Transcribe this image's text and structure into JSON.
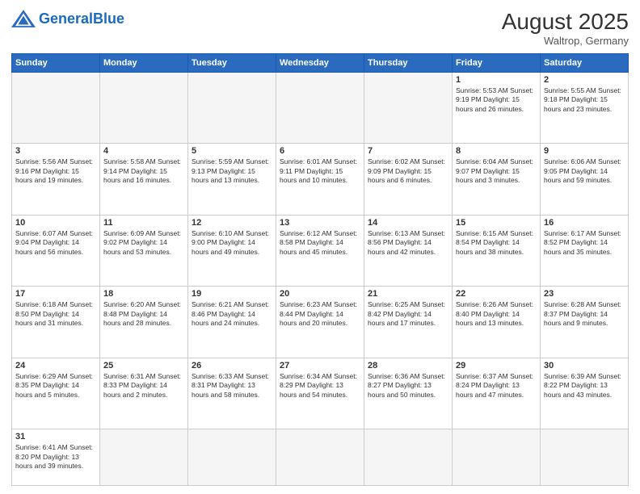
{
  "header": {
    "logo_general": "General",
    "logo_blue": "Blue",
    "month_year": "August 2025",
    "location": "Waltrop, Germany"
  },
  "weekdays": [
    "Sunday",
    "Monday",
    "Tuesday",
    "Wednesday",
    "Thursday",
    "Friday",
    "Saturday"
  ],
  "weeks": [
    [
      {
        "day": "",
        "info": ""
      },
      {
        "day": "",
        "info": ""
      },
      {
        "day": "",
        "info": ""
      },
      {
        "day": "",
        "info": ""
      },
      {
        "day": "",
        "info": ""
      },
      {
        "day": "1",
        "info": "Sunrise: 5:53 AM\nSunset: 9:19 PM\nDaylight: 15 hours and 26 minutes."
      },
      {
        "day": "2",
        "info": "Sunrise: 5:55 AM\nSunset: 9:18 PM\nDaylight: 15 hours and 23 minutes."
      }
    ],
    [
      {
        "day": "3",
        "info": "Sunrise: 5:56 AM\nSunset: 9:16 PM\nDaylight: 15 hours and 19 minutes."
      },
      {
        "day": "4",
        "info": "Sunrise: 5:58 AM\nSunset: 9:14 PM\nDaylight: 15 hours and 16 minutes."
      },
      {
        "day": "5",
        "info": "Sunrise: 5:59 AM\nSunset: 9:13 PM\nDaylight: 15 hours and 13 minutes."
      },
      {
        "day": "6",
        "info": "Sunrise: 6:01 AM\nSunset: 9:11 PM\nDaylight: 15 hours and 10 minutes."
      },
      {
        "day": "7",
        "info": "Sunrise: 6:02 AM\nSunset: 9:09 PM\nDaylight: 15 hours and 6 minutes."
      },
      {
        "day": "8",
        "info": "Sunrise: 6:04 AM\nSunset: 9:07 PM\nDaylight: 15 hours and 3 minutes."
      },
      {
        "day": "9",
        "info": "Sunrise: 6:06 AM\nSunset: 9:05 PM\nDaylight: 14 hours and 59 minutes."
      }
    ],
    [
      {
        "day": "10",
        "info": "Sunrise: 6:07 AM\nSunset: 9:04 PM\nDaylight: 14 hours and 56 minutes."
      },
      {
        "day": "11",
        "info": "Sunrise: 6:09 AM\nSunset: 9:02 PM\nDaylight: 14 hours and 53 minutes."
      },
      {
        "day": "12",
        "info": "Sunrise: 6:10 AM\nSunset: 9:00 PM\nDaylight: 14 hours and 49 minutes."
      },
      {
        "day": "13",
        "info": "Sunrise: 6:12 AM\nSunset: 8:58 PM\nDaylight: 14 hours and 45 minutes."
      },
      {
        "day": "14",
        "info": "Sunrise: 6:13 AM\nSunset: 8:56 PM\nDaylight: 14 hours and 42 minutes."
      },
      {
        "day": "15",
        "info": "Sunrise: 6:15 AM\nSunset: 8:54 PM\nDaylight: 14 hours and 38 minutes."
      },
      {
        "day": "16",
        "info": "Sunrise: 6:17 AM\nSunset: 8:52 PM\nDaylight: 14 hours and 35 minutes."
      }
    ],
    [
      {
        "day": "17",
        "info": "Sunrise: 6:18 AM\nSunset: 8:50 PM\nDaylight: 14 hours and 31 minutes."
      },
      {
        "day": "18",
        "info": "Sunrise: 6:20 AM\nSunset: 8:48 PM\nDaylight: 14 hours and 28 minutes."
      },
      {
        "day": "19",
        "info": "Sunrise: 6:21 AM\nSunset: 8:46 PM\nDaylight: 14 hours and 24 minutes."
      },
      {
        "day": "20",
        "info": "Sunrise: 6:23 AM\nSunset: 8:44 PM\nDaylight: 14 hours and 20 minutes."
      },
      {
        "day": "21",
        "info": "Sunrise: 6:25 AM\nSunset: 8:42 PM\nDaylight: 14 hours and 17 minutes."
      },
      {
        "day": "22",
        "info": "Sunrise: 6:26 AM\nSunset: 8:40 PM\nDaylight: 14 hours and 13 minutes."
      },
      {
        "day": "23",
        "info": "Sunrise: 6:28 AM\nSunset: 8:37 PM\nDaylight: 14 hours and 9 minutes."
      }
    ],
    [
      {
        "day": "24",
        "info": "Sunrise: 6:29 AM\nSunset: 8:35 PM\nDaylight: 14 hours and 5 minutes."
      },
      {
        "day": "25",
        "info": "Sunrise: 6:31 AM\nSunset: 8:33 PM\nDaylight: 14 hours and 2 minutes."
      },
      {
        "day": "26",
        "info": "Sunrise: 6:33 AM\nSunset: 8:31 PM\nDaylight: 13 hours and 58 minutes."
      },
      {
        "day": "27",
        "info": "Sunrise: 6:34 AM\nSunset: 8:29 PM\nDaylight: 13 hours and 54 minutes."
      },
      {
        "day": "28",
        "info": "Sunrise: 6:36 AM\nSunset: 8:27 PM\nDaylight: 13 hours and 50 minutes."
      },
      {
        "day": "29",
        "info": "Sunrise: 6:37 AM\nSunset: 8:24 PM\nDaylight: 13 hours and 47 minutes."
      },
      {
        "day": "30",
        "info": "Sunrise: 6:39 AM\nSunset: 8:22 PM\nDaylight: 13 hours and 43 minutes."
      }
    ],
    [
      {
        "day": "31",
        "info": "Sunrise: 6:41 AM\nSunset: 8:20 PM\nDaylight: 13 hours and 39 minutes."
      },
      {
        "day": "",
        "info": ""
      },
      {
        "day": "",
        "info": ""
      },
      {
        "day": "",
        "info": ""
      },
      {
        "day": "",
        "info": ""
      },
      {
        "day": "",
        "info": ""
      },
      {
        "day": "",
        "info": ""
      }
    ]
  ]
}
